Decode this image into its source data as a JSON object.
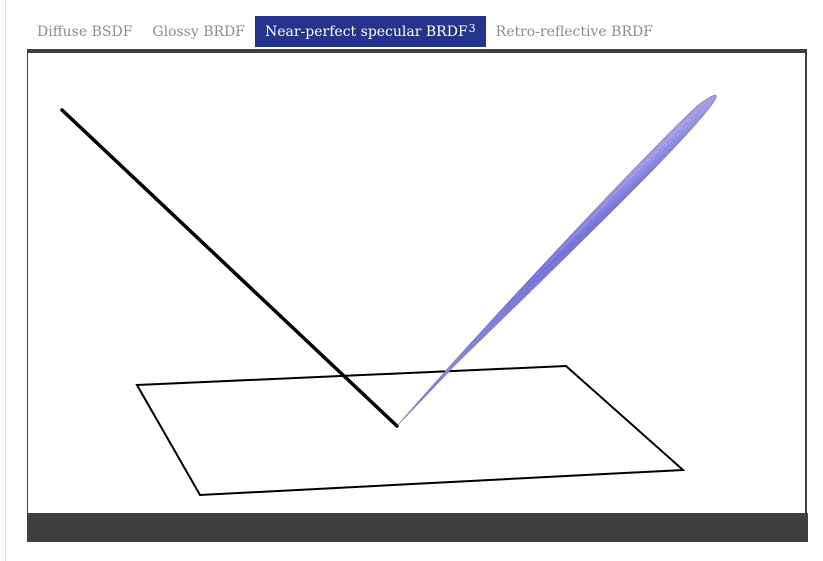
{
  "tabs": [
    {
      "label": "Diffuse BSDF",
      "active": false
    },
    {
      "label": "Glossy BRDF",
      "active": false
    },
    {
      "label": "Near-perfect specular BRDF",
      "superscript": "3",
      "active": true
    },
    {
      "label": "Retro-reflective BRDF",
      "active": false
    }
  ],
  "colors": {
    "active_tab": "#24338b",
    "inactive_tab_text": "#8e8e8e",
    "frame": "#404040",
    "lobe": "#7f84e0"
  },
  "scene_icons": {
    "incident_ray": "incident-ray",
    "surface_plane": "surface-plane",
    "reflection_lobe": "specular-lobe"
  }
}
